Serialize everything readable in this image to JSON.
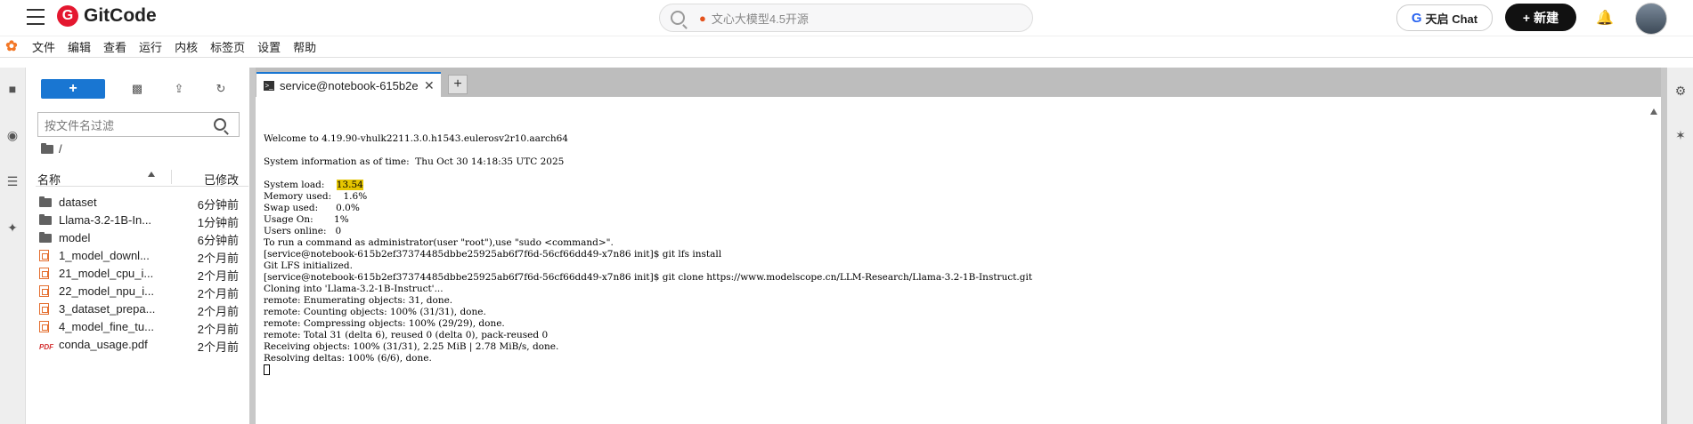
{
  "header": {
    "logo_mark": "G",
    "logo_text": "GitCode",
    "search_placeholder": "文心大模型4.5开源",
    "chat_button": "天启 Chat",
    "chat_icon": "G",
    "new_button": "新建",
    "new_icon": "+"
  },
  "menu": {
    "items": [
      "文件",
      "编辑",
      "查看",
      "运行",
      "内核",
      "标签页",
      "设置",
      "帮助"
    ]
  },
  "left_sidebar_icons": [
    "folder-icon",
    "running-icon",
    "toc-icon",
    "extension-icon"
  ],
  "file_browser": {
    "new_button": "+",
    "filter_placeholder": "按文件名过滤",
    "breadcrumb": "/",
    "col_name": "名称",
    "col_modified": "已修改",
    "files": [
      {
        "name": "dataset",
        "modified": "6分钟前",
        "type": "folder"
      },
      {
        "name": "Llama-3.2-1B-In...",
        "modified": "1分钟前",
        "type": "folder"
      },
      {
        "name": "model",
        "modified": "6分钟前",
        "type": "folder"
      },
      {
        "name": "1_model_downl...",
        "modified": "2个月前",
        "type": "notebook"
      },
      {
        "name": "21_model_cpu_i...",
        "modified": "2个月前",
        "type": "notebook"
      },
      {
        "name": "22_model_npu_i...",
        "modified": "2个月前",
        "type": "notebook"
      },
      {
        "name": "3_dataset_prepa...",
        "modified": "2个月前",
        "type": "notebook"
      },
      {
        "name": "4_model_fine_tu...",
        "modified": "2个月前",
        "type": "notebook"
      },
      {
        "name": "conda_usage.pdf",
        "modified": "2个月前",
        "type": "pdf"
      }
    ]
  },
  "tabs": {
    "active_label": "service@notebook-615b2e",
    "close": "✕",
    "add": "+"
  },
  "terminal": {
    "welcome": "Welcome to 4.19.90-vhulk2211.3.0.h1543.eulerosv2r10.aarch64",
    "sysinfo": "System information as of time:  Thu Oct 30 14:18:35 UTC 2025",
    "load_label": "System load:    ",
    "load_value": "13.54",
    "lines_after": [
      "Memory used:    1.6%",
      "Swap used:      0.0%",
      "Usage On:       1%",
      "Users online:   0",
      "To run a command as administrator(user \"root\"),use \"sudo <command>\".",
      "[service@notebook-615b2ef37374485dbbe25925ab6f7f6d-56cf66dd49-x7n86 init]$ git lfs install",
      "Git LFS initialized.",
      "[service@notebook-615b2ef37374485dbbe25925ab6f7f6d-56cf66dd49-x7n86 init]$ git clone https://www.modelscope.cn/LLM-Research/Llama-3.2-1B-Instruct.git",
      "Cloning into 'Llama-3.2-1B-Instruct'...",
      "remote: Enumerating objects: 31, done.",
      "remote: Counting objects: 100% (31/31), done.",
      "remote: Compressing objects: 100% (29/29), done.",
      "remote: Total 31 (delta 6), reused 0 (delta 0), pack-reused 0",
      "Receiving objects: 100% (31/31), 2.25 MiB | 2.78 MiB/s, done.",
      "Resolving deltas: 100% (6/6), done."
    ]
  },
  "right_sidebar_icons": [
    "property-inspector-icon",
    "debugger-icon"
  ]
}
